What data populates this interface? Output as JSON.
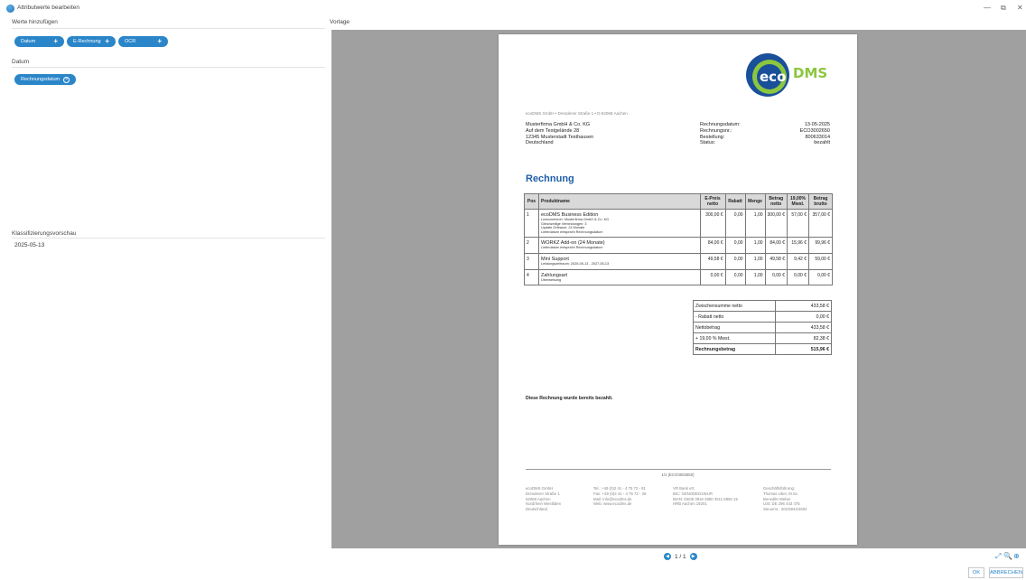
{
  "window": {
    "title": "Attributwerte bearbeiten",
    "minimize": "—",
    "restore": "⧉",
    "close": "✕"
  },
  "left": {
    "values_label": "Werte hinzufügen",
    "chips": [
      {
        "label": "Datum",
        "plus": "+"
      },
      {
        "label": "E-Rechnung",
        "plus": "+"
      },
      {
        "label": "OCR",
        "plus": "+"
      }
    ],
    "datum_label": "Datum",
    "selected_chip": {
      "label": "Rechnungsdatum",
      "remove": "×"
    },
    "preview_label": "Klassifizierungsvorschau",
    "preview_value": "2025-05-13"
  },
  "right": {
    "vorlage_label": "Vorlage"
  },
  "document": {
    "sender_line": "ecoDMS GmbH • Dresdener Straße 1 • D-52068 Aachen",
    "address": [
      "Musterfirma GmbH & Co. KG",
      "Auf dem Testgelände 28",
      "12345 Musterstadt Testhausen",
      "Deutschland"
    ],
    "meta_labels": [
      "Rechnungsdatum:",
      "Rechnungsnr.:",
      "Bestellung:",
      "Status:"
    ],
    "meta_values": [
      "13-05-2025",
      "ECO3002650",
      "800633014",
      "bezahlt"
    ],
    "title": "Rechnung",
    "table": {
      "headers": [
        "Pos",
        "Produktname",
        "E-Preis netto",
        "Rabatt",
        "Menge",
        "Betrag netto",
        "19,00% Mwst.",
        "Betrag brutto"
      ],
      "rows": [
        {
          "pos": "1",
          "name": "ecoDMS Business Edition",
          "details": [
            "Lizenznehmer: Musterfirma GmbH & Co. KG",
            "Gleichzeitige Verbindungen: 3",
            "Update Zeitraum: 24 Monate",
            "Lieferdatum entspricht Rechnungsdatum"
          ],
          "price": "300,00 €",
          "discount": "0,00",
          "qty": "1,00",
          "net": "300,00 €",
          "vat": "57,00 €",
          "gross": "357,00 €"
        },
        {
          "pos": "2",
          "name": "WORKZ Add-on (24 Monate)",
          "details": [
            "Lieferdatum entspricht Rechnungsdatum"
          ],
          "price": "84,00 €",
          "discount": "0,00",
          "qty": "1,00",
          "net": "84,00 €",
          "vat": "15,96 €",
          "gross": "99,96 €"
        },
        {
          "pos": "3",
          "name": "Mini Support",
          "details": [
            "Leistungszeitraum: 2025-05-13 - 2027-05-13"
          ],
          "price": "49,58 €",
          "discount": "0,00",
          "qty": "1,00",
          "net": "49,58 €",
          "vat": "9,42 €",
          "gross": "59,00 €"
        },
        {
          "pos": "4",
          "name": "Zahlungsart",
          "details": [
            "Überweisung"
          ],
          "price": "0,00 €",
          "discount": "0,00",
          "qty": "1,00",
          "net": "0,00 €",
          "vat": "0,00 €",
          "gross": "0,00 €"
        }
      ]
    },
    "totals": [
      {
        "label": "Zwischensumme netto",
        "value": "433,58 €"
      },
      {
        "label": "- Rabatt netto",
        "value": "0,00 €"
      },
      {
        "label": "Nettobetrag",
        "value": "433,58 €"
      },
      {
        "label": "+ 19,00 % Mwst.",
        "value": "82,38 €"
      },
      {
        "label": "Rechnungsbetrag",
        "value": "515,96 €"
      }
    ],
    "paid_note": "Diese Rechnung wurde bereits bezahlt.",
    "footer_page": "1/1 (ECO3002650)",
    "footer_cols": [
      [
        "ecoDMS GmbH",
        "Dresdener Straße 1",
        "52068 Aachen",
        "Nordrhein Westfalen",
        "Deutschland"
      ],
      [
        "Tel.: +49 (0)2 41 - 4 75 72 - 81",
        "Fax: +49 (0)2 41 - 4 75 72 - 29",
        "Mail: info@ecodms.de",
        "Web: www.ecodms.de"
      ],
      [
        "VR Bank eG",
        "BIC: GENODED1WUR",
        "IBAN: DE08 3916 2980 3511 5850 15",
        "HRB Aachen 19201"
      ],
      [
        "Geschäftsführung:",
        "Thomas Uber, M.Sc.",
        "Benedikt Weber",
        "USt: DE 296 443 475",
        "Steuernr.: 201/5944/4602"
      ]
    ]
  },
  "viewer": {
    "page_indicator": "1 / 1",
    "prev": "◀",
    "next": "▶",
    "zoom_icons": [
      "⤢",
      "🔍",
      "⊕"
    ]
  },
  "buttons": {
    "ok": "OK",
    "cancel": "ABBRECHEN"
  },
  "colors": {
    "accent": "#2b86c9",
    "doc_title": "#1f5fa8",
    "viewer_bg": "#a0a0a0"
  }
}
